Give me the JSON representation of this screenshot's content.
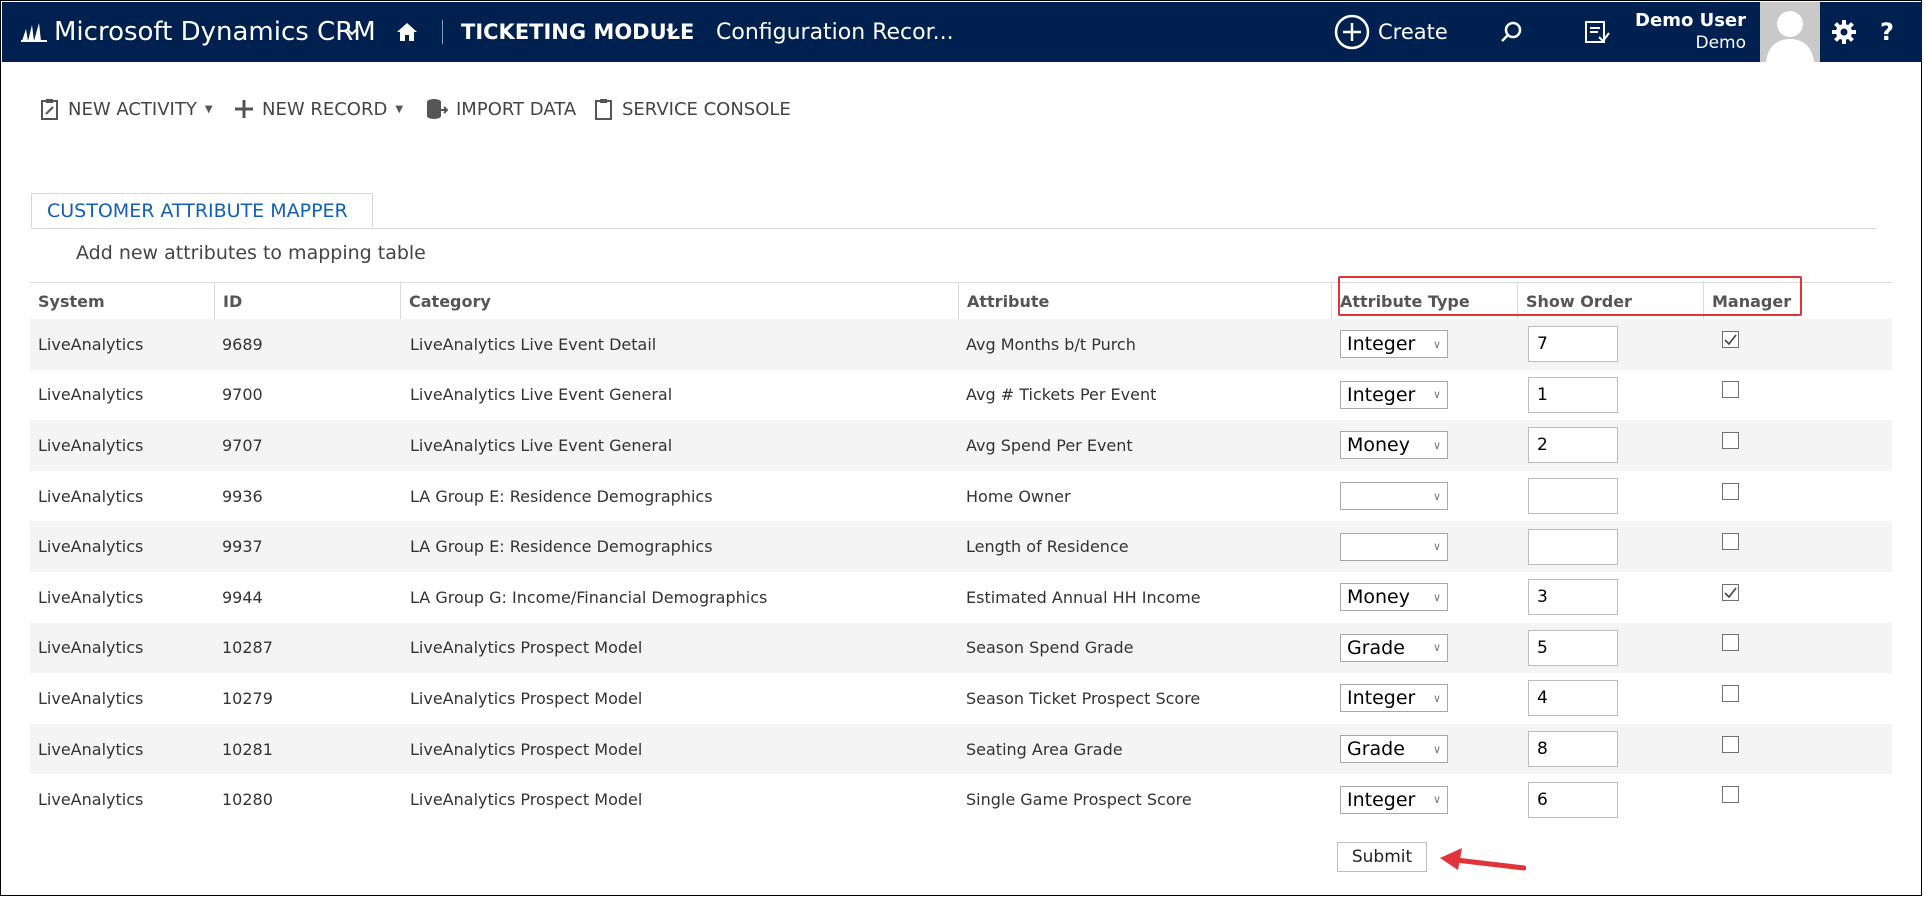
{
  "nav": {
    "brand": "Microsoft Dynamics CRM",
    "module": "TICKETING MODULE",
    "record": "Configuration Recor...",
    "create": "Create",
    "user_name": "Demo User",
    "user_org": "Demo",
    "help": "?",
    "icons": [
      "dynamics-logo-icon",
      "chevron-down-icon",
      "home-icon",
      "plus-circle-icon",
      "search-icon",
      "recent-records-icon",
      "avatar",
      "gear-icon",
      "help-icon"
    ]
  },
  "commands": {
    "new_activity": "NEW ACTIVITY",
    "new_record": "NEW RECORD",
    "import_data": "IMPORT DATA",
    "service_console": "SERVICE CONSOLE"
  },
  "tab": {
    "label": "CUSTOMER ATTRIBUTE MAPPER"
  },
  "subtitle": "Add new attributes to mapping table",
  "table": {
    "headers": {
      "system": "System",
      "id": "ID",
      "category": "Category",
      "attribute": "Attribute",
      "attribute_type": "Attribute Type",
      "show_order": "Show Order",
      "manager": "Manager"
    },
    "rows": [
      {
        "system": "LiveAnalytics",
        "id": "9689",
        "category": "LiveAnalytics Live Event Detail",
        "attribute": "Avg Months b/t Purch",
        "type": "Integer",
        "order": "7",
        "manager": true
      },
      {
        "system": "LiveAnalytics",
        "id": "9700",
        "category": "LiveAnalytics Live Event General",
        "attribute": "Avg # Tickets Per Event",
        "type": "Integer",
        "order": "1",
        "manager": false
      },
      {
        "system": "LiveAnalytics",
        "id": "9707",
        "category": "LiveAnalytics Live Event General",
        "attribute": "Avg Spend Per Event",
        "type": "Money",
        "order": "2",
        "manager": false
      },
      {
        "system": "LiveAnalytics",
        "id": "9936",
        "category": "LA Group E: Residence Demographics",
        "attribute": "Home Owner",
        "type": "",
        "order": "",
        "manager": false
      },
      {
        "system": "LiveAnalytics",
        "id": "9937",
        "category": "LA Group E: Residence Demographics",
        "attribute": "Length of Residence",
        "type": "",
        "order": "",
        "manager": false
      },
      {
        "system": "LiveAnalytics",
        "id": "9944",
        "category": "LA Group G: Income/Financial Demographics",
        "attribute": "Estimated Annual HH Income",
        "type": "Money",
        "order": "3",
        "manager": true
      },
      {
        "system": "LiveAnalytics",
        "id": "10287",
        "category": "LiveAnalytics Prospect Model",
        "attribute": "Season Spend Grade",
        "type": "Grade",
        "order": "5",
        "manager": false
      },
      {
        "system": "LiveAnalytics",
        "id": "10279",
        "category": "LiveAnalytics Prospect Model",
        "attribute": "Season Ticket Prospect Score",
        "type": "Integer",
        "order": "4",
        "manager": false
      },
      {
        "system": "LiveAnalytics",
        "id": "10281",
        "category": "LiveAnalytics Prospect Model",
        "attribute": "Seating Area Grade",
        "type": "Grade",
        "order": "8",
        "manager": false
      },
      {
        "system": "LiveAnalytics",
        "id": "10280",
        "category": "LiveAnalytics Prospect Model",
        "attribute": "Single Game Prospect Score",
        "type": "Integer",
        "order": "6",
        "manager": false
      }
    ]
  },
  "submit": "Submit",
  "colors": {
    "nav_bg": "#002050",
    "tab_text": "#1160b7",
    "highlight": "#e0343a",
    "row_alt": "#f4f4f4"
  }
}
